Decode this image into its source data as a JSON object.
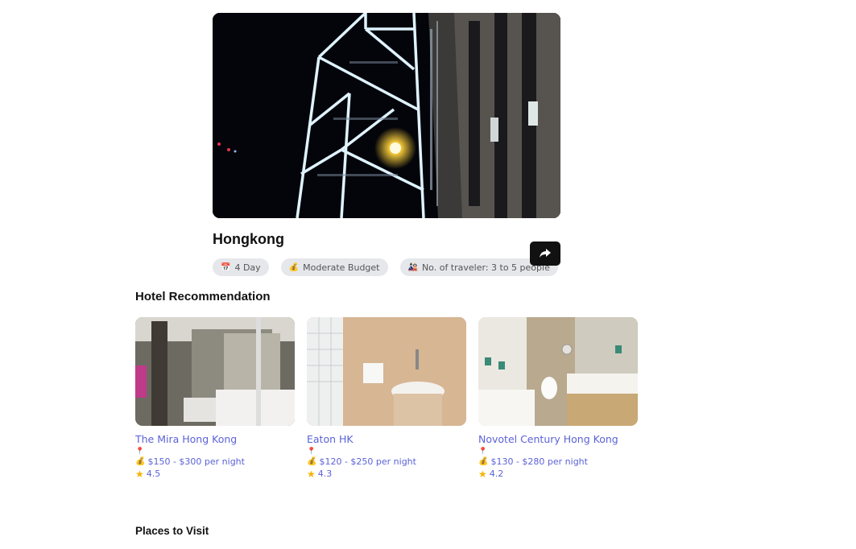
{
  "destination": {
    "name": "Hongkong",
    "chips": [
      {
        "icon": "calendar-icon",
        "label": "4 Day"
      },
      {
        "icon": "money-bag-icon",
        "label": "Moderate Budget"
      },
      {
        "icon": "travelers-icon",
        "label": "No. of traveler: 3 to 5 people"
      }
    ]
  },
  "sections": {
    "hotels_title": "Hotel Recommendation",
    "places_title": "Places to Visit"
  },
  "hotels": [
    {
      "name": "The Mira Hong Kong",
      "price": "$150 - $300 per night",
      "rating": "4.5"
    },
    {
      "name": "Eaton HK",
      "price": "$120 - $250 per night",
      "rating": "4.3"
    },
    {
      "name": "Novotel Century Hong Kong",
      "price": "$130 - $280 per night",
      "rating": "4.2"
    }
  ],
  "colors": {
    "accent_link": "#5b62d6",
    "chip_bg": "#e5e7eb",
    "button_bg": "#111111"
  }
}
